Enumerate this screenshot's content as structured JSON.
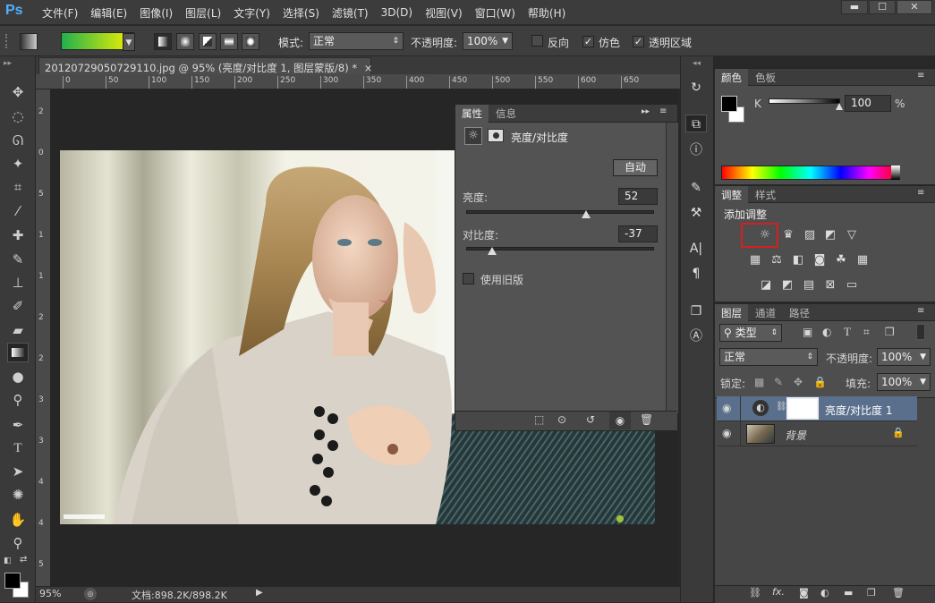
{
  "app": {
    "logo": "Ps"
  },
  "menu": [
    "文件(F)",
    "编辑(E)",
    "图像(I)",
    "图层(L)",
    "文字(Y)",
    "选择(S)",
    "滤镜(T)",
    "3D(D)",
    "视图(V)",
    "窗口(W)",
    "帮助(H)"
  ],
  "window_controls": {
    "minimize": "▬",
    "maximize": "☐",
    "close": "✕"
  },
  "options": {
    "mode_label": "模式:",
    "mode_value": "正常",
    "opacity_label": "不透明度:",
    "opacity_value": "100%",
    "reverse_label": "反向",
    "dither_label": "仿色",
    "transparency_label": "透明区域",
    "dither_checked": true,
    "transparency_checked": true,
    "reverse_checked": false
  },
  "document": {
    "tab_title": "20120729050729110.jpg @ 95% (亮度/对比度 1, 图层蒙版/8) *",
    "close_glyph": "×",
    "ruler_h_ticks": [
      "0",
      "50",
      "100",
      "150",
      "200",
      "250",
      "300",
      "350",
      "400",
      "450",
      "500",
      "550",
      "600",
      "650"
    ],
    "ruler_v_ticks": [
      "2",
      "0",
      "5",
      "1",
      "1",
      "2",
      "2",
      "3",
      "3",
      "4",
      "4",
      "5"
    ]
  },
  "status": {
    "zoom": "95%",
    "doc_info": "文档:898.2K/898.2K"
  },
  "properties": {
    "tabs": [
      "属性",
      "信息"
    ],
    "title": "亮度/对比度",
    "auto_button": "自动",
    "brightness_label": "亮度:",
    "brightness_value": "52",
    "brightness_fraction": 0.64,
    "contrast_label": "对比度:",
    "contrast_value": "-37",
    "contrast_fraction": 0.14,
    "legacy_label": "使用旧版",
    "legacy_checked": false
  },
  "color_panel": {
    "tabs": [
      "颜色",
      "色板"
    ],
    "channel_label": "K",
    "channel_value": "100",
    "percent_sign": "%"
  },
  "adjustments_panel": {
    "tabs": [
      "调整",
      "样式"
    ],
    "add_label": "添加调整",
    "row1_icons": [
      "brightness-contrast-icon",
      "levels-icon",
      "curves-icon",
      "exposure-icon",
      "vibrance-icon"
    ],
    "row2_icons": [
      "hue-saturation-icon",
      "color-balance-icon",
      "black-white-icon",
      "photo-filter-icon",
      "channel-mixer-icon",
      "color-lookup-icon"
    ],
    "row3_icons": [
      "invert-icon",
      "posterize-icon",
      "threshold-icon",
      "selective-color-icon",
      "gradient-map-icon"
    ]
  },
  "layers_panel": {
    "tabs": [
      "图层",
      "通道",
      "路径"
    ],
    "filter_label": "类型",
    "blend_mode": "正常",
    "opacity_label": "不透明度:",
    "opacity_value": "100%",
    "lock_label": "锁定:",
    "fill_label": "填充:",
    "fill_value": "100%",
    "layers": [
      {
        "name": "亮度/对比度 1",
        "selected": true
      },
      {
        "name": "背景",
        "selected": false
      }
    ]
  },
  "colors": {
    "accent_red": "#d42020",
    "selected_layer": "#5a6f8c",
    "photoshop_blue": "#4fb0ff"
  }
}
